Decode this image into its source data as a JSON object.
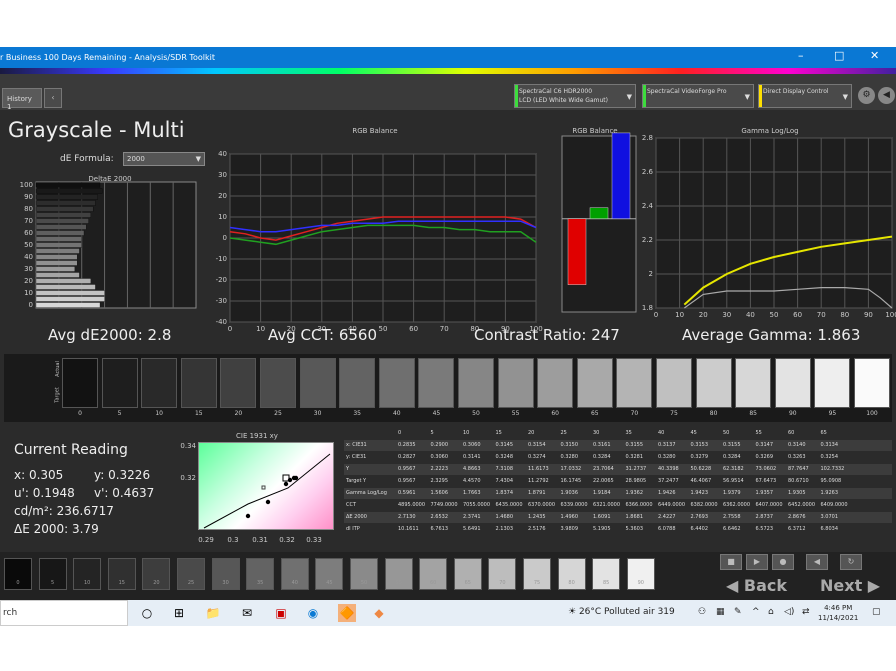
{
  "window": {
    "title": "r Business 100 Days Remaining - Analysis/SDR Toolkit",
    "minimize": "–",
    "maximize": "□",
    "close": "✕"
  },
  "tabs": {
    "history": "History 1",
    "close": "‹"
  },
  "devices": [
    {
      "line1": "SpectraCal C6 HDR2000",
      "line2": "LCD (LED White Wide Gamut)",
      "color": "#3ddc3d"
    },
    {
      "line1": "SpectraCal VideoForge Pro",
      "line2": "",
      "color": "#3ddc3d"
    },
    {
      "line1": "Direct Display Control",
      "line2": "",
      "color": "#ffe000"
    }
  ],
  "icons": {
    "settings": "⚙",
    "back": "◀",
    "dropdown": "▼"
  },
  "section_title": "Grayscale - Multi",
  "formula": {
    "label": "dE Formula:",
    "value": "2000"
  },
  "charts": {
    "deltae_title": "DeltaE 2000",
    "rgb_title": "RGB Balance",
    "rgbbar_title": "RGB Balance",
    "gamma_title": "Gamma Log/Log"
  },
  "summary": {
    "avg_de": "Avg dE2000: 2.8",
    "avg_cct": "Avg CCT: 6560",
    "contrast": "Contrast Ratio: 247",
    "avg_gamma": "Average Gamma: 1.863"
  },
  "chart_data": [
    {
      "type": "bar",
      "title": "DeltaE 2000",
      "orientation": "horizontal",
      "y_ticks": [
        "100",
        "95",
        "90",
        "85",
        "80",
        "75",
        "70",
        "65",
        "60",
        "55",
        "50",
        "45",
        "40",
        "35",
        "30",
        "25",
        "20",
        "15",
        "10",
        "5",
        "0"
      ],
      "values": [
        2.8,
        2.9,
        2.7,
        2.6,
        2.5,
        2.4,
        2.3,
        2.2,
        2.1,
        2.0,
        2.0,
        1.9,
        1.8,
        1.8,
        1.7,
        1.9,
        2.4,
        2.6,
        3.0,
        3.0,
        2.8
      ]
    },
    {
      "type": "line",
      "title": "RGB Balance",
      "x": [
        0,
        5,
        10,
        15,
        20,
        25,
        30,
        35,
        40,
        45,
        50,
        55,
        60,
        65,
        70,
        75,
        80,
        85,
        90,
        95,
        100
      ],
      "y_ticks": [
        -40,
        -30,
        -20,
        -10,
        0,
        10,
        20,
        30,
        40
      ],
      "x_ticks": [
        0,
        10,
        20,
        30,
        40,
        50,
        60,
        70,
        80,
        90,
        100
      ],
      "series": [
        {
          "color": "#e02020",
          "values": [
            3,
            2,
            0,
            -1,
            1,
            3,
            5,
            7,
            8,
            9,
            10,
            10,
            10,
            10,
            10,
            10,
            10,
            10,
            10,
            9,
            5
          ]
        },
        {
          "color": "#20a020",
          "values": [
            0,
            -1,
            -2,
            -3,
            -1,
            1,
            3,
            4,
            5,
            6,
            6,
            6,
            6,
            5,
            5,
            4,
            4,
            3,
            3,
            3,
            -2
          ]
        },
        {
          "color": "#3030ff",
          "values": [
            5,
            4,
            3,
            3,
            4,
            5,
            6,
            6,
            7,
            7,
            7,
            8,
            8,
            8,
            8,
            8,
            8,
            8,
            8,
            8,
            5
          ]
        }
      ]
    },
    {
      "type": "bar",
      "title": "RGB Balance",
      "categories": [
        "R",
        "G",
        "B"
      ],
      "values": [
        -6,
        1,
        7.8
      ],
      "colors": [
        "#e00000",
        "#00a000",
        "#1010e0"
      ]
    },
    {
      "type": "line",
      "title": "Gamma Log/Log",
      "x_ticks": [
        0,
        10,
        20,
        30,
        40,
        50,
        60,
        70,
        80,
        90,
        100
      ],
      "y_ticks": [
        1.8,
        2,
        2.2,
        2.4,
        2.6,
        2.8
      ],
      "series": [
        {
          "color": "#e6e600",
          "x": [
            12,
            20,
            30,
            40,
            50,
            60,
            70,
            80,
            90,
            100
          ],
          "values": [
            1.82,
            1.92,
            2.0,
            2.06,
            2.1,
            2.13,
            2.16,
            2.18,
            2.2,
            2.22
          ]
        },
        {
          "color": "#aaaaaa",
          "x": [
            12,
            20,
            30,
            40,
            50,
            60,
            70,
            80,
            90,
            95,
            100
          ],
          "values": [
            1.8,
            1.88,
            1.9,
            1.9,
            1.9,
            1.91,
            1.92,
            1.92,
            1.91,
            1.86,
            1.8
          ]
        }
      ]
    },
    {
      "type": "scatter",
      "title": "CIE 1931 xy",
      "x_ticks": [
        "0.29",
        "0.3",
        "0.31",
        "0.32",
        "0.33"
      ],
      "y_ticks": [
        "0.34",
        "0.32"
      ]
    }
  ],
  "swatches": {
    "labels": [
      "0",
      "5",
      "10",
      "15",
      "20",
      "25",
      "30",
      "35",
      "40",
      "45",
      "50",
      "55",
      "60",
      "65",
      "70",
      "75",
      "80",
      "85",
      "90",
      "95",
      "100"
    ],
    "actual_label": "Actual",
    "target_label": "Target"
  },
  "reading": {
    "title": "Current Reading",
    "x": "x: 0.305",
    "y": "y: 0.3226",
    "u": "u': 0.1948",
    "v": "v': 0.4637",
    "cd": "cd/m²: 236.6717",
    "de": "ΔE 2000: 3.79"
  },
  "table": {
    "headers": [
      "",
      "0",
      "5",
      "10",
      "15",
      "20",
      "25",
      "30",
      "35",
      "40",
      "45",
      "50",
      "55",
      "60",
      "65"
    ],
    "rows": [
      [
        "x: CIE31",
        "0.2835",
        "0.2900",
        "0.3060",
        "0.3145",
        "0.3154",
        "0.3150",
        "0.3161",
        "0.3155",
        "0.3137",
        "0.3153",
        "0.3155",
        "0.3147",
        "0.3140",
        "0.3134"
      ],
      [
        "y: CIE31",
        "0.2827",
        "0.3060",
        "0.3141",
        "0.3248",
        "0.3274",
        "0.3280",
        "0.3284",
        "0.3281",
        "0.3280",
        "0.3279",
        "0.3284",
        "0.3269",
        "0.3263",
        "0.3254"
      ],
      [
        "Y",
        "0.9567",
        "2.2223",
        "4.8663",
        "7.3108",
        "11.6173",
        "17.0332",
        "23.7064",
        "31.2737",
        "40.3398",
        "50.6228",
        "62.3182",
        "73.0602",
        "87.7647",
        "102.7332"
      ],
      [
        "Target Y",
        "0.9567",
        "2.3295",
        "4.4570",
        "7.4304",
        "11.2792",
        "16.1745",
        "22.0065",
        "28.9805",
        "37.2477",
        "46.4067",
        "56.9514",
        "67.6473",
        "80.6710",
        "95.0908"
      ],
      [
        "Gamma Log/Log",
        "0.5961",
        "1.5606",
        "1.7663",
        "1.8374",
        "1.8791",
        "1.9036",
        "1.9184",
        "1.9362",
        "1.9426",
        "1.9423",
        "1.9379",
        "1.9357",
        "1.9305",
        "1.9263"
      ],
      [
        "CCT",
        "4895.0000",
        "7749.0000",
        "7055.0000",
        "6435.0000",
        "6370.0000",
        "6339.0000",
        "6321.0000",
        "6366.0000",
        "6449.0000",
        "6382.0000",
        "6362.0000",
        "6407.0000",
        "6452.0000",
        "6409.0000"
      ],
      [
        "ΔE 2000",
        "2.7130",
        "2.6532",
        "2.3741",
        "1.4680",
        "1.2435",
        "1.4960",
        "1.6091",
        "1.8681",
        "2.4227",
        "2.7693",
        "2.7558",
        "2.8737",
        "2.8676",
        "3.0701"
      ],
      [
        "dI ITP",
        "10.1611",
        "6.7613",
        "5.6491",
        "2.1303",
        "2.5176",
        "3.9809",
        "5.1905",
        "5.3603",
        "6.0788",
        "6.4402",
        "6.6462",
        "6.5723",
        "6.3712",
        "6.8034"
      ]
    ]
  },
  "filmstrip": {
    "labels": [
      "0",
      "5",
      "10",
      "15",
      "20",
      "25",
      "30",
      "35",
      "40",
      "45",
      "50",
      "55",
      "60",
      "65",
      "70",
      "75",
      "80",
      "85",
      "90"
    ],
    "back": "Back",
    "next": "Next"
  },
  "taskbar": {
    "search": "rch",
    "weather": "26°C  Polluted air 319",
    "time": "4:46 PM",
    "date": "11/14/2021",
    "icons": [
      "○",
      "⊞",
      "📁",
      "✉",
      "▣",
      "◉",
      "🔶",
      "◆"
    ]
  }
}
